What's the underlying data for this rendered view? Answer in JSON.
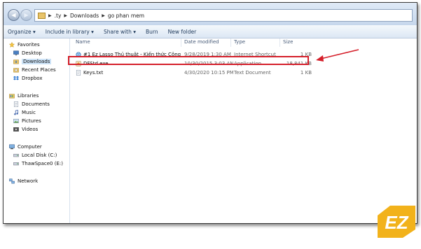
{
  "address": {
    "crumbs": [
      ".ty",
      "Downloads",
      "go phan mem"
    ]
  },
  "toolbar": {
    "organize": "Organize ▾",
    "include": "Include in library ▾",
    "share": "Share with ▾",
    "burn": "Burn",
    "new_folder": "New folder"
  },
  "nav": {
    "favorites": "Favorites",
    "desktop": "Desktop",
    "downloads": "Downloads",
    "recent": "Recent Places",
    "dropbox": "Dropbox",
    "libraries": "Libraries",
    "documents": "Documents",
    "music": "Music",
    "pictures": "Pictures",
    "videos": "Videos",
    "computer": "Computer",
    "local_disk": "Local Disk (C:)",
    "thawspace": "ThawSpace0 (E:)",
    "network": "Network"
  },
  "columns": {
    "name": "Name",
    "date": "Date modified",
    "type": "Type",
    "size": "Size"
  },
  "files": [
    {
      "name": "#1 Ez Lasso Thủ thuật - Kiến thức Công ...",
      "date": "9/28/2019 1:30 AM",
      "type": "Internet Shortcut",
      "size": "1 KB",
      "icon": "internet-shortcut-icon"
    },
    {
      "name": "DFStd.exe",
      "date": "10/30/2015 3:03 AM",
      "type": "Application",
      "size": "18,841 KB",
      "icon": "application-icon"
    },
    {
      "name": "Keys.txt",
      "date": "4/30/2020 10:15 PM",
      "type": "Text Document",
      "size": "1 KB",
      "icon": "text-file-icon"
    }
  ],
  "logo": {
    "text": "EZ"
  },
  "colors": {
    "highlight": "#d51f2a",
    "logo": "#f2b21b",
    "accent": "#1e395b"
  }
}
